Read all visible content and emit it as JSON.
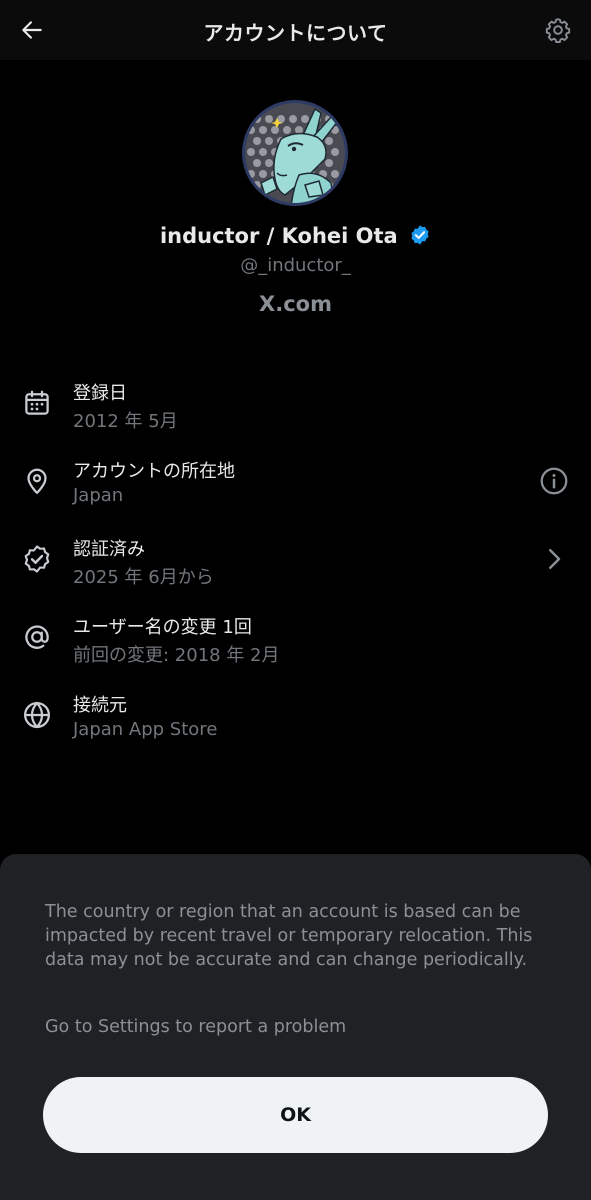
{
  "colors": {
    "background": "#000000",
    "header_bg": "#0b0b0b",
    "primary_text": "#e7e9ea",
    "secondary_text": "#71767b",
    "verified_blue": "#1d9bf0",
    "sheet_bg": "#202124",
    "button_bg": "#eff3f4"
  },
  "header": {
    "title": "アカウントについて",
    "back_icon": "arrow-left-icon",
    "settings_icon": "gear-icon"
  },
  "profile": {
    "display_name": "inductor / Kohei Ota",
    "handle": "@_inductor_",
    "brand": "X.com",
    "avatar_icon": "donkey-avatar"
  },
  "rows": [
    {
      "icon": "calendar-icon",
      "title": "登録日",
      "subtitle": "2012 年 5月"
    },
    {
      "icon": "location-pin-icon",
      "title": "アカウントの所在地",
      "subtitle": "Japan",
      "trailing": "info-icon"
    },
    {
      "icon": "verified-badge-icon",
      "title": "認証済み",
      "subtitle": "2025 年 6月から",
      "trailing": "chevron-right-icon"
    },
    {
      "icon": "at-sign-icon",
      "title": "ユーザー名の変更 1回",
      "subtitle": "前回の変更: 2018 年 2月"
    },
    {
      "icon": "globe-icon",
      "title": "接続元",
      "subtitle": "Japan App Store"
    }
  ],
  "sheet": {
    "message": "The country or region that an account is based can be impacted by recent travel or temporary relocation. This data may not be accurate and can change periodically.",
    "link": "Go to Settings to report a problem",
    "ok_label": "OK"
  }
}
